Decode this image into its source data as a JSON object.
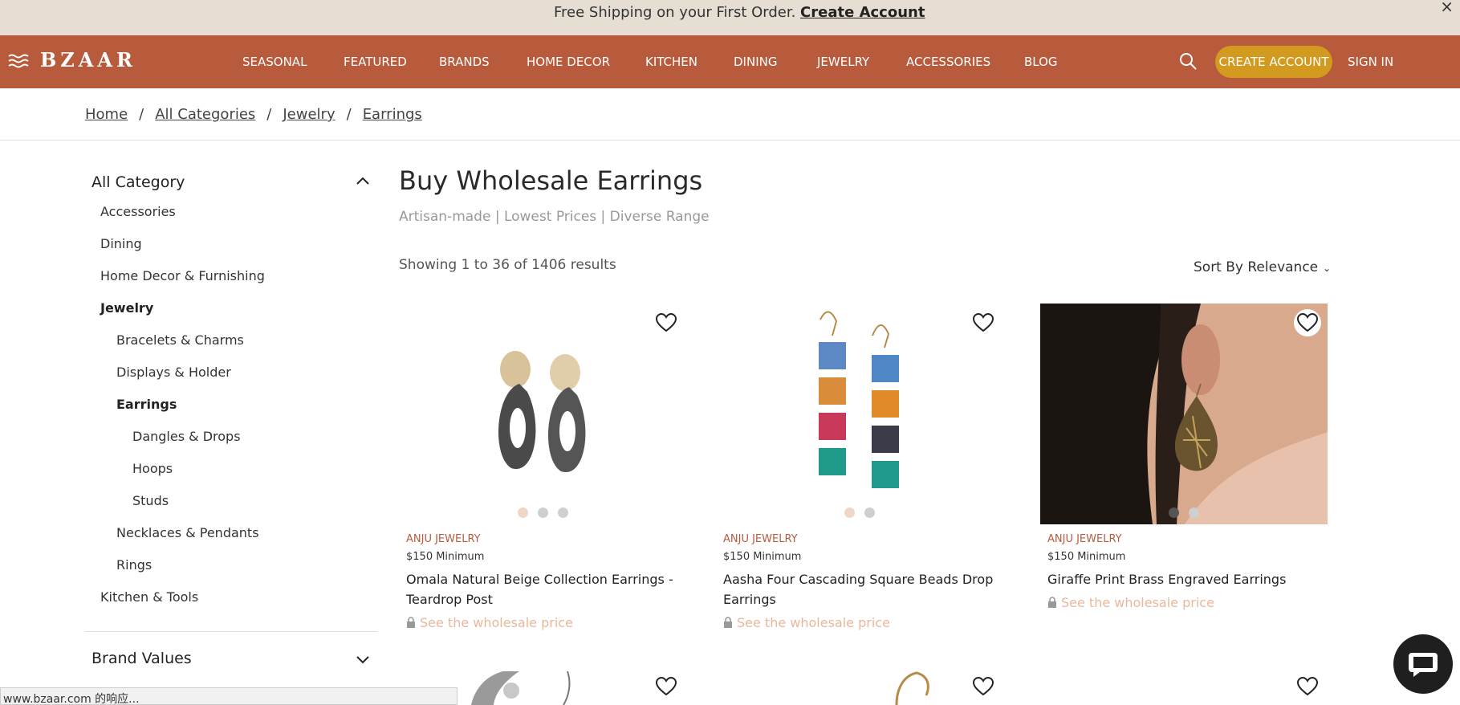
{
  "promo": {
    "text": "Free Shipping on your First Order. ",
    "link": "Create Account",
    "close": "×"
  },
  "nav": {
    "logo": "BZAAR",
    "links": [
      "SEASONAL",
      "FEATURED",
      "BRANDS",
      "HOME DECOR",
      "KITCHEN",
      "DINING",
      "JEWELRY",
      "ACCESSORIES",
      "BLOG"
    ],
    "create_account": "CREATE ACCOUNT",
    "sign_in": "SIGN IN"
  },
  "breadcrumb": {
    "items": [
      "Home",
      "All Categories",
      "Jewelry",
      "Earrings"
    ],
    "separator": "/"
  },
  "sidebar": {
    "heading": "All Category",
    "categories": [
      "Accessories",
      "Dining",
      "Home Decor & Furnishing",
      "Jewelry",
      "Bracelets & Charms",
      "Displays & Holder",
      "Earrings",
      "Dangles & Drops",
      "Hoops",
      "Studs",
      "Necklaces & Pendants",
      "Rings",
      "Kitchen & Tools"
    ],
    "brand_values": "Brand Values"
  },
  "main": {
    "title": "Buy Wholesale Earrings",
    "subtitle": "Artisan-made | Lowest Prices | Diverse Range",
    "showing": "Showing 1 to 36 of 1406 results",
    "sort": "Sort By Relevance"
  },
  "products": [
    {
      "brand": "ANJU JEWELRY",
      "minimum": "$150 Minimum",
      "name": "Omala Natural Beige Collection Earrings - Teardrop Post",
      "price_text": "See the wholesale price"
    },
    {
      "brand": "ANJU JEWELRY",
      "minimum": "$150 Minimum",
      "name": "Aasha Four Cascading Square Beads Drop Earrings",
      "price_text": "See the wholesale price"
    },
    {
      "brand": "ANJU JEWELRY",
      "minimum": "$150 Minimum",
      "name": "Giraffe Print Brass Engraved Earrings",
      "price_text": "See the wholesale price"
    }
  ],
  "status_bar": "www.bzaar.com 的响应...",
  "colors": {
    "nav_bg": "#b85a3c",
    "promo_bg": "#e6ddd3",
    "create_btn": "#d29a1f",
    "brand_text": "#b85a3c",
    "price_link": "#e8b89c"
  }
}
